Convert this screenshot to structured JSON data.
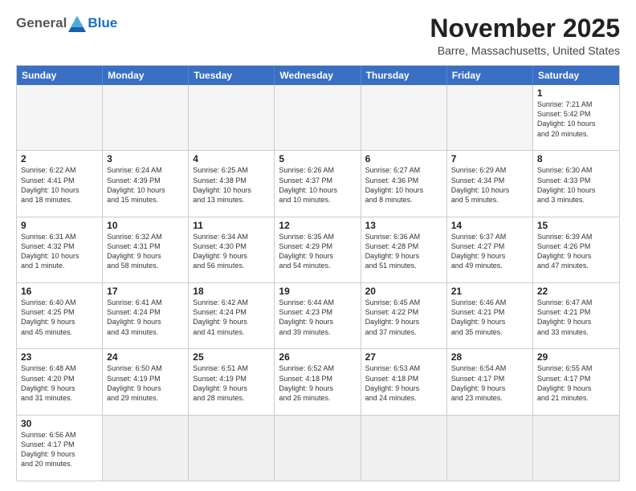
{
  "header": {
    "logo_general": "General",
    "logo_blue": "Blue",
    "month_title": "November 2025",
    "location": "Barre, Massachusetts, United States"
  },
  "weekdays": [
    "Sunday",
    "Monday",
    "Tuesday",
    "Wednesday",
    "Thursday",
    "Friday",
    "Saturday"
  ],
  "rows": [
    [
      {
        "day": "",
        "info": ""
      },
      {
        "day": "",
        "info": ""
      },
      {
        "day": "",
        "info": ""
      },
      {
        "day": "",
        "info": ""
      },
      {
        "day": "",
        "info": ""
      },
      {
        "day": "",
        "info": ""
      },
      {
        "day": "1",
        "info": "Sunrise: 7:21 AM\nSunset: 5:42 PM\nDaylight: 10 hours\nand 20 minutes."
      }
    ],
    [
      {
        "day": "2",
        "info": "Sunrise: 6:22 AM\nSunset: 4:41 PM\nDaylight: 10 hours\nand 18 minutes."
      },
      {
        "day": "3",
        "info": "Sunrise: 6:24 AM\nSunset: 4:39 PM\nDaylight: 10 hours\nand 15 minutes."
      },
      {
        "day": "4",
        "info": "Sunrise: 6:25 AM\nSunset: 4:38 PM\nDaylight: 10 hours\nand 13 minutes."
      },
      {
        "day": "5",
        "info": "Sunrise: 6:26 AM\nSunset: 4:37 PM\nDaylight: 10 hours\nand 10 minutes."
      },
      {
        "day": "6",
        "info": "Sunrise: 6:27 AM\nSunset: 4:36 PM\nDaylight: 10 hours\nand 8 minutes."
      },
      {
        "day": "7",
        "info": "Sunrise: 6:29 AM\nSunset: 4:34 PM\nDaylight: 10 hours\nand 5 minutes."
      },
      {
        "day": "8",
        "info": "Sunrise: 6:30 AM\nSunset: 4:33 PM\nDaylight: 10 hours\nand 3 minutes."
      }
    ],
    [
      {
        "day": "9",
        "info": "Sunrise: 6:31 AM\nSunset: 4:32 PM\nDaylight: 10 hours\nand 1 minute."
      },
      {
        "day": "10",
        "info": "Sunrise: 6:32 AM\nSunset: 4:31 PM\nDaylight: 9 hours\nand 58 minutes."
      },
      {
        "day": "11",
        "info": "Sunrise: 6:34 AM\nSunset: 4:30 PM\nDaylight: 9 hours\nand 56 minutes."
      },
      {
        "day": "12",
        "info": "Sunrise: 6:35 AM\nSunset: 4:29 PM\nDaylight: 9 hours\nand 54 minutes."
      },
      {
        "day": "13",
        "info": "Sunrise: 6:36 AM\nSunset: 4:28 PM\nDaylight: 9 hours\nand 51 minutes."
      },
      {
        "day": "14",
        "info": "Sunrise: 6:37 AM\nSunset: 4:27 PM\nDaylight: 9 hours\nand 49 minutes."
      },
      {
        "day": "15",
        "info": "Sunrise: 6:39 AM\nSunset: 4:26 PM\nDaylight: 9 hours\nand 47 minutes."
      }
    ],
    [
      {
        "day": "16",
        "info": "Sunrise: 6:40 AM\nSunset: 4:25 PM\nDaylight: 9 hours\nand 45 minutes."
      },
      {
        "day": "17",
        "info": "Sunrise: 6:41 AM\nSunset: 4:24 PM\nDaylight: 9 hours\nand 43 minutes."
      },
      {
        "day": "18",
        "info": "Sunrise: 6:42 AM\nSunset: 4:24 PM\nDaylight: 9 hours\nand 41 minutes."
      },
      {
        "day": "19",
        "info": "Sunrise: 6:44 AM\nSunset: 4:23 PM\nDaylight: 9 hours\nand 39 minutes."
      },
      {
        "day": "20",
        "info": "Sunrise: 6:45 AM\nSunset: 4:22 PM\nDaylight: 9 hours\nand 37 minutes."
      },
      {
        "day": "21",
        "info": "Sunrise: 6:46 AM\nSunset: 4:21 PM\nDaylight: 9 hours\nand 35 minutes."
      },
      {
        "day": "22",
        "info": "Sunrise: 6:47 AM\nSunset: 4:21 PM\nDaylight: 9 hours\nand 33 minutes."
      }
    ],
    [
      {
        "day": "23",
        "info": "Sunrise: 6:48 AM\nSunset: 4:20 PM\nDaylight: 9 hours\nand 31 minutes."
      },
      {
        "day": "24",
        "info": "Sunrise: 6:50 AM\nSunset: 4:19 PM\nDaylight: 9 hours\nand 29 minutes."
      },
      {
        "day": "25",
        "info": "Sunrise: 6:51 AM\nSunset: 4:19 PM\nDaylight: 9 hours\nand 28 minutes."
      },
      {
        "day": "26",
        "info": "Sunrise: 6:52 AM\nSunset: 4:18 PM\nDaylight: 9 hours\nand 26 minutes."
      },
      {
        "day": "27",
        "info": "Sunrise: 6:53 AM\nSunset: 4:18 PM\nDaylight: 9 hours\nand 24 minutes."
      },
      {
        "day": "28",
        "info": "Sunrise: 6:54 AM\nSunset: 4:17 PM\nDaylight: 9 hours\nand 23 minutes."
      },
      {
        "day": "29",
        "info": "Sunrise: 6:55 AM\nSunset: 4:17 PM\nDaylight: 9 hours\nand 21 minutes."
      }
    ],
    [
      {
        "day": "30",
        "info": "Sunrise: 6:56 AM\nSunset: 4:17 PM\nDaylight: 9 hours\nand 20 minutes."
      },
      {
        "day": "",
        "info": ""
      },
      {
        "day": "",
        "info": ""
      },
      {
        "day": "",
        "info": ""
      },
      {
        "day": "",
        "info": ""
      },
      {
        "day": "",
        "info": ""
      },
      {
        "day": "",
        "info": ""
      }
    ]
  ]
}
